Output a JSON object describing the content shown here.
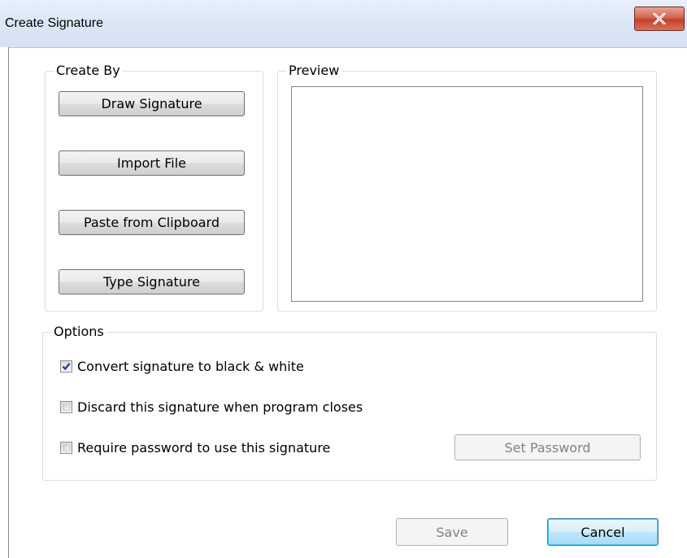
{
  "window": {
    "title": "Create Signature"
  },
  "create_by": {
    "legend": "Create By",
    "buttons": [
      {
        "label": "Draw Signature"
      },
      {
        "label": "Import File"
      },
      {
        "label": "Paste from Clipboard"
      },
      {
        "label": "Type Signature"
      }
    ]
  },
  "preview": {
    "legend": "Preview"
  },
  "options": {
    "legend": "Options",
    "items": [
      {
        "label": "Convert signature to black & white",
        "checked": true
      },
      {
        "label": "Discard this signature when program closes",
        "checked": false
      },
      {
        "label": "Require password to use this signature",
        "checked": false
      }
    ],
    "set_password_label": "Set Password",
    "set_password_enabled": false
  },
  "footer": {
    "save_label": "Save",
    "save_enabled": false,
    "cancel_label": "Cancel"
  },
  "icons": {
    "close": "close-icon",
    "checkmark": "checkmark-icon"
  },
  "colors": {
    "close_button": "#c2412c",
    "default_button_border": "#3c7fb1",
    "checkmark": "#1c3f8c"
  }
}
